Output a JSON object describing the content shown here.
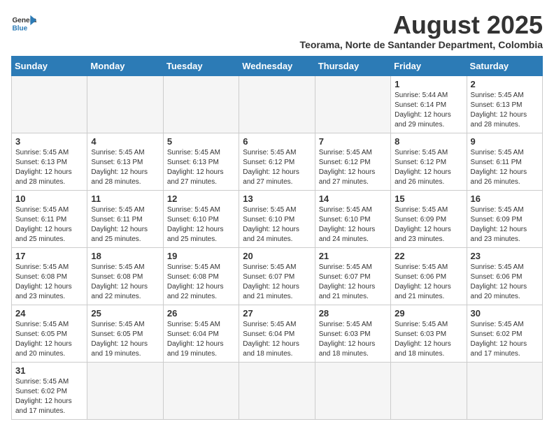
{
  "header": {
    "logo_general": "General",
    "logo_blue": "Blue",
    "title": "August 2025",
    "subtitle": "Teorama, Norte de Santander Department, Colombia"
  },
  "days_of_week": [
    "Sunday",
    "Monday",
    "Tuesday",
    "Wednesday",
    "Thursday",
    "Friday",
    "Saturday"
  ],
  "weeks": [
    [
      {
        "day": "",
        "info": ""
      },
      {
        "day": "",
        "info": ""
      },
      {
        "day": "",
        "info": ""
      },
      {
        "day": "",
        "info": ""
      },
      {
        "day": "",
        "info": ""
      },
      {
        "day": "1",
        "info": "Sunrise: 5:44 AM\nSunset: 6:14 PM\nDaylight: 12 hours\nand 29 minutes."
      },
      {
        "day": "2",
        "info": "Sunrise: 5:45 AM\nSunset: 6:13 PM\nDaylight: 12 hours\nand 28 minutes."
      }
    ],
    [
      {
        "day": "3",
        "info": "Sunrise: 5:45 AM\nSunset: 6:13 PM\nDaylight: 12 hours\nand 28 minutes."
      },
      {
        "day": "4",
        "info": "Sunrise: 5:45 AM\nSunset: 6:13 PM\nDaylight: 12 hours\nand 28 minutes."
      },
      {
        "day": "5",
        "info": "Sunrise: 5:45 AM\nSunset: 6:13 PM\nDaylight: 12 hours\nand 27 minutes."
      },
      {
        "day": "6",
        "info": "Sunrise: 5:45 AM\nSunset: 6:12 PM\nDaylight: 12 hours\nand 27 minutes."
      },
      {
        "day": "7",
        "info": "Sunrise: 5:45 AM\nSunset: 6:12 PM\nDaylight: 12 hours\nand 27 minutes."
      },
      {
        "day": "8",
        "info": "Sunrise: 5:45 AM\nSunset: 6:12 PM\nDaylight: 12 hours\nand 26 minutes."
      },
      {
        "day": "9",
        "info": "Sunrise: 5:45 AM\nSunset: 6:11 PM\nDaylight: 12 hours\nand 26 minutes."
      }
    ],
    [
      {
        "day": "10",
        "info": "Sunrise: 5:45 AM\nSunset: 6:11 PM\nDaylight: 12 hours\nand 25 minutes."
      },
      {
        "day": "11",
        "info": "Sunrise: 5:45 AM\nSunset: 6:11 PM\nDaylight: 12 hours\nand 25 minutes."
      },
      {
        "day": "12",
        "info": "Sunrise: 5:45 AM\nSunset: 6:10 PM\nDaylight: 12 hours\nand 25 minutes."
      },
      {
        "day": "13",
        "info": "Sunrise: 5:45 AM\nSunset: 6:10 PM\nDaylight: 12 hours\nand 24 minutes."
      },
      {
        "day": "14",
        "info": "Sunrise: 5:45 AM\nSunset: 6:10 PM\nDaylight: 12 hours\nand 24 minutes."
      },
      {
        "day": "15",
        "info": "Sunrise: 5:45 AM\nSunset: 6:09 PM\nDaylight: 12 hours\nand 23 minutes."
      },
      {
        "day": "16",
        "info": "Sunrise: 5:45 AM\nSunset: 6:09 PM\nDaylight: 12 hours\nand 23 minutes."
      }
    ],
    [
      {
        "day": "17",
        "info": "Sunrise: 5:45 AM\nSunset: 6:08 PM\nDaylight: 12 hours\nand 23 minutes."
      },
      {
        "day": "18",
        "info": "Sunrise: 5:45 AM\nSunset: 6:08 PM\nDaylight: 12 hours\nand 22 minutes."
      },
      {
        "day": "19",
        "info": "Sunrise: 5:45 AM\nSunset: 6:08 PM\nDaylight: 12 hours\nand 22 minutes."
      },
      {
        "day": "20",
        "info": "Sunrise: 5:45 AM\nSunset: 6:07 PM\nDaylight: 12 hours\nand 21 minutes."
      },
      {
        "day": "21",
        "info": "Sunrise: 5:45 AM\nSunset: 6:07 PM\nDaylight: 12 hours\nand 21 minutes."
      },
      {
        "day": "22",
        "info": "Sunrise: 5:45 AM\nSunset: 6:06 PM\nDaylight: 12 hours\nand 21 minutes."
      },
      {
        "day": "23",
        "info": "Sunrise: 5:45 AM\nSunset: 6:06 PM\nDaylight: 12 hours\nand 20 minutes."
      }
    ],
    [
      {
        "day": "24",
        "info": "Sunrise: 5:45 AM\nSunset: 6:05 PM\nDaylight: 12 hours\nand 20 minutes."
      },
      {
        "day": "25",
        "info": "Sunrise: 5:45 AM\nSunset: 6:05 PM\nDaylight: 12 hours\nand 19 minutes."
      },
      {
        "day": "26",
        "info": "Sunrise: 5:45 AM\nSunset: 6:04 PM\nDaylight: 12 hours\nand 19 minutes."
      },
      {
        "day": "27",
        "info": "Sunrise: 5:45 AM\nSunset: 6:04 PM\nDaylight: 12 hours\nand 18 minutes."
      },
      {
        "day": "28",
        "info": "Sunrise: 5:45 AM\nSunset: 6:03 PM\nDaylight: 12 hours\nand 18 minutes."
      },
      {
        "day": "29",
        "info": "Sunrise: 5:45 AM\nSunset: 6:03 PM\nDaylight: 12 hours\nand 18 minutes."
      },
      {
        "day": "30",
        "info": "Sunrise: 5:45 AM\nSunset: 6:02 PM\nDaylight: 12 hours\nand 17 minutes."
      }
    ],
    [
      {
        "day": "31",
        "info": "Sunrise: 5:45 AM\nSunset: 6:02 PM\nDaylight: 12 hours\nand 17 minutes."
      },
      {
        "day": "",
        "info": ""
      },
      {
        "day": "",
        "info": ""
      },
      {
        "day": "",
        "info": ""
      },
      {
        "day": "",
        "info": ""
      },
      {
        "day": "",
        "info": ""
      },
      {
        "day": "",
        "info": ""
      }
    ]
  ]
}
